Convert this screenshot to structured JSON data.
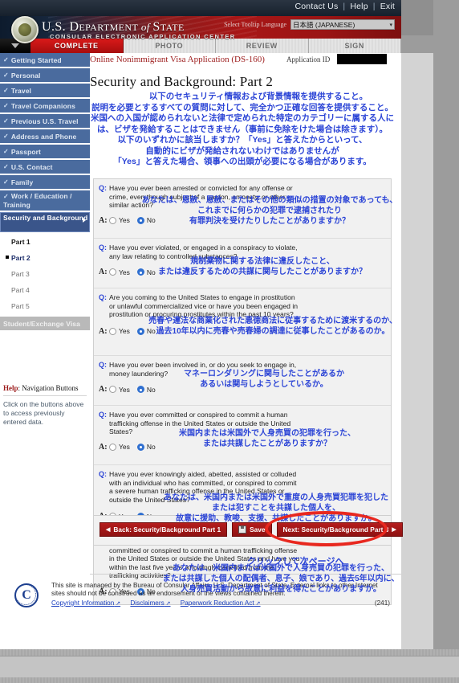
{
  "topbar": {
    "contact": "Contact Us",
    "help": "Help",
    "exit": "Exit"
  },
  "banner": {
    "title_us": "U.S. ",
    "title_dept": "D",
    "title_dept_rest": "EPARTMENT",
    "title_of": " of ",
    "title_state_cap": "S",
    "title_state_rest": "TATE",
    "subtitle": "CONSULAR ELECTRONIC APPLICATION CENTER",
    "tooltip_label": "Select Tooltip Language",
    "tooltip_value": "日本語 (JAPANESE)"
  },
  "tabs": [
    {
      "label": "COMPLETE",
      "active": true
    },
    {
      "label": "PHOTO",
      "active": false
    },
    {
      "label": "REVIEW",
      "active": false
    },
    {
      "label": "SIGN",
      "active": false
    }
  ],
  "sidebar": {
    "items": [
      {
        "label": "Getting Started",
        "state": "done"
      },
      {
        "label": "Personal",
        "state": "done"
      },
      {
        "label": "Travel",
        "state": "done"
      },
      {
        "label": "Travel Companions",
        "state": "done"
      },
      {
        "label": "Previous U.S. Travel",
        "state": "done"
      },
      {
        "label": "Address and Phone",
        "state": "done"
      },
      {
        "label": "Passport",
        "state": "done"
      },
      {
        "label": "U.S. Contact",
        "state": "done"
      },
      {
        "label": "Family",
        "state": "done"
      },
      {
        "label": "Work / Education / Training",
        "state": "done"
      },
      {
        "label": "Security and Background",
        "state": "current"
      }
    ],
    "subitems": [
      {
        "label": "Part 1",
        "selected": false
      },
      {
        "label": "Part 2",
        "selected": true
      },
      {
        "label": "Part 3",
        "selected": false
      },
      {
        "label": "Part 4",
        "selected": false
      },
      {
        "label": "Part 5",
        "selected": false
      }
    ],
    "disabled_item": "Student/Exchange Visa",
    "help": {
      "title_bold": "Help",
      "title_rest": ": Navigation Buttons",
      "body": "Click on the buttons above to access previously entered data."
    }
  },
  "header": {
    "app_title": "Online Nonimmigrant Visa Application (DS-160)",
    "application_id_label": "Application ID",
    "page_title": "Security and Background: Part 2"
  },
  "intro_jp": [
    "以下のセキュリティ情報および背景情報を提供すること。",
    "説明を必要とするすべての質問に対して、完全かつ正確な回答を提供すること。",
    "米国への入国が認められないと法律で定められた特定のカテゴリーに属する人に",
    "は、ビザを発給することはできません（事前に免除をけた場合は除きます）。",
    "以下のいずれかに該当しますか？「Yes」と答えたからといって、",
    "自動的にビザが発給されないわけではありませんが",
    "「Yes」と答えた場合、領事への出頭が必要になる場合があります。"
  ],
  "labels": {
    "q_mark": "Q:",
    "a_mark": "A:",
    "yes": "Yes",
    "no": "No"
  },
  "questions": [
    {
      "text": "Have you ever been arrested or convicted for any offense or crime, even though subject of a pardon, amnesty, or other similar action?",
      "answer": "No",
      "jp": [
        "あなたは、恩赦、恩赦、またはその他の類似の措置の対象であっても、",
        "これまでに何らかの犯罪で逮捕されたり",
        "有罪判決を受けたりしたことがありますか？"
      ]
    },
    {
      "text": "Have you ever violated, or engaged in a conspiracy to violate, any law relating to controlled substances?",
      "answer": "No",
      "jp": [
        "規制薬物に関する法律に違反したこと、",
        "または違反するための共謀に関与したことがありますか？"
      ]
    },
    {
      "text": "Are you coming to the United States to engage in prostitution or unlawful commercialized vice or have you been engaged in prostitution or procuring prostitutes within the past 10 years?",
      "answer": "No",
      "jp": [
        "売春や違法な商業化された悪徳商法に従事するために渡米するのか、",
        "過去10年以内に売春や売春婦の調達に従事したことがあるのか。"
      ]
    },
    {
      "text": "Have you ever been involved in, or do you seek to engage in, money laundering?",
      "answer": "No",
      "jp": [
        "マネーロンダリングに関与したことがあるか",
        "あるいは関与しようとしているか。"
      ]
    },
    {
      "text": "Have you ever committed or conspired to commit a human trafficking offense in the United States or outside the United States?",
      "answer": "No",
      "jp": [
        "米国内または米国外で人身売買の犯罪を行った、",
        "または共謀したことがありますか？"
      ]
    },
    {
      "text": "Have you ever knowingly aided, abetted, assisted or colluded with an individual who has committed, or conspired to commit a severe human trafficking offense in the United States or outside the United States?",
      "answer": "No",
      "jp": [
        "あなたは、米国内または米国外で重度の人身売買犯罪を犯した",
        "または犯すことを共謀した個人を、",
        "故意に援助、教唆、支援、共謀したことがありますか。"
      ]
    },
    {
      "text": "Are you the spouse, son, or daughter of an individual who has committed or conspired to commit a human trafficking offense in the United States or outside the United States and have you within the last five years, knowingly benefited from the trafficking activities?",
      "answer": "No",
      "jp": [
        "あなたは、米国内または米国外で人身売買の犯罪を行った、",
        "または共謀した個人の配偶者、息子、娘であり、過去5年以内に、",
        "人身売買活動から故意に利益を得たことがありますか。"
      ]
    }
  ],
  "buttons": {
    "back": "Back: Security/Background Part 1",
    "save": "Save",
    "next": "Next: Security/Background Part 3"
  },
  "annotation_click_jp": "クリックして次ページへ",
  "footer": {
    "text": "This site is managed by the Bureau of Consular Affairs, U.S. Department of State. External links to other Internet sites should not be construed as an endorsement of the views contained therein.",
    "links": [
      "Copyright Information",
      "Disclaimers",
      "Paperwork Reduction Act"
    ],
    "number": "(241)",
    "seal_letter": "C"
  },
  "colors": {
    "accent_red": "#a81616",
    "nav_blue": "#4a6b9e",
    "jp_blue": "#2b44d6",
    "annotation_red": "#e8281f"
  }
}
